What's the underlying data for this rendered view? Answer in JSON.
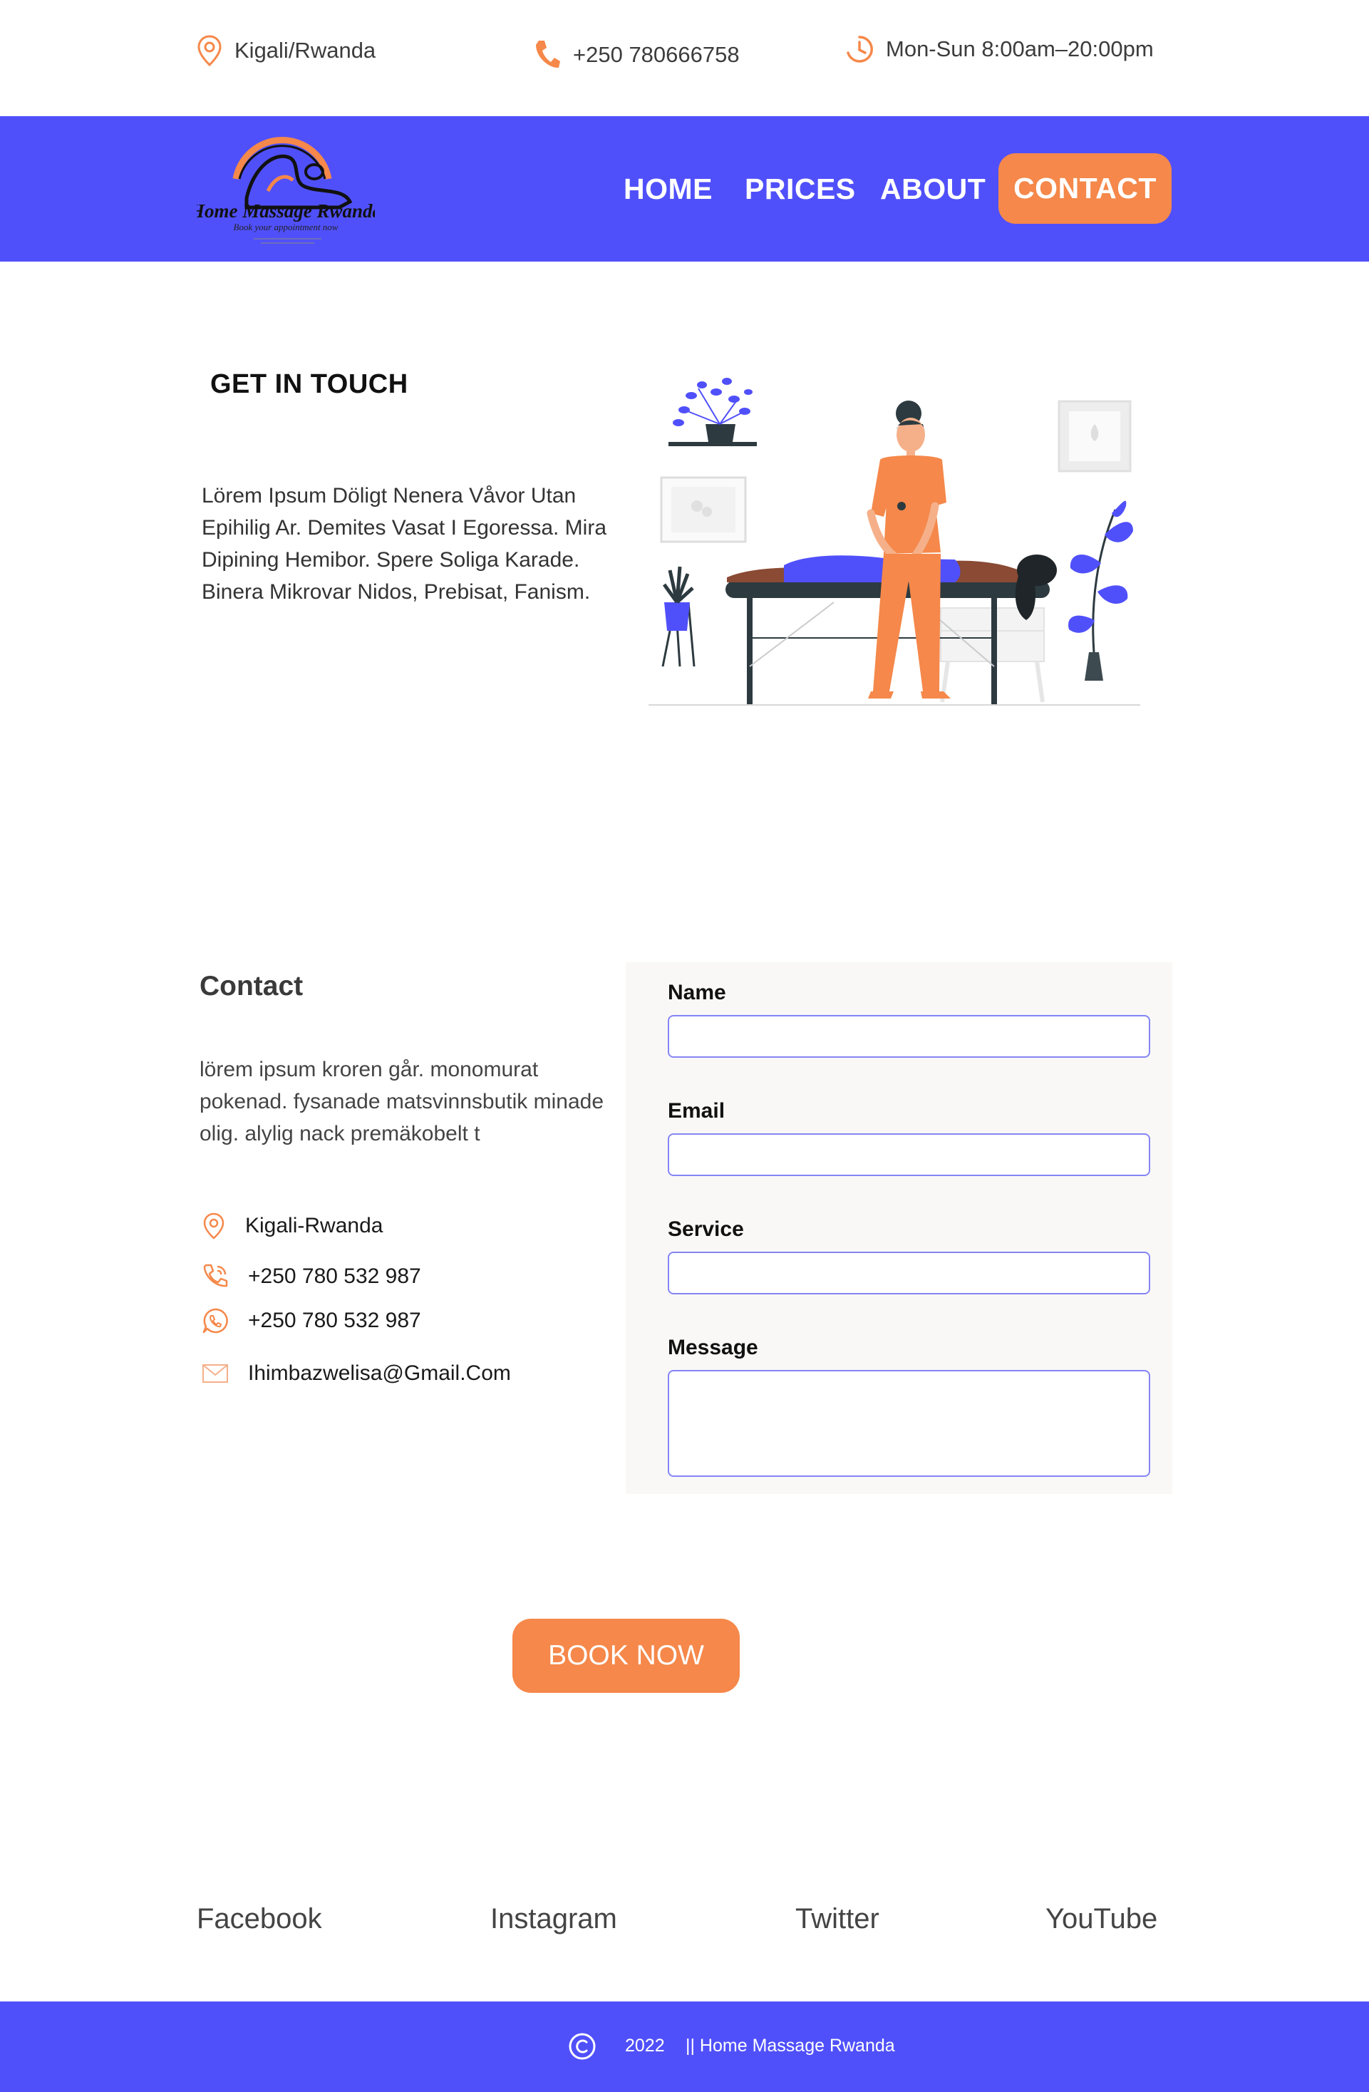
{
  "topbar": {
    "location": "Kigali/Rwanda",
    "phone": "+250 780666758",
    "hours": "Mon-Sun 8:00am–20:00pm"
  },
  "nav": {
    "logo_title": "Home Massage Rwanda",
    "logo_tagline": "Book your appointment now",
    "home": "HOME",
    "prices": "PRICES",
    "about": "ABOUT",
    "contact": "CONTACT"
  },
  "touch": {
    "title": "GET IN  TOUCH",
    "body": "Lörem Ipsum Döligt Nenera Våvor Utan Epihilig Ar. Demites Vasat I Egoressa. Mira Dipining Hemibor. Spere Soliga Karade. Binera Mikrovar Nidos, Prebisat, Fanism."
  },
  "contact": {
    "title": "Contact",
    "body": "lörem ipsum kroren går. monomurat pokenad. fysanade matsvinnsbutik minade olig. alylig nack premäkobelt t",
    "address": "Kigali-Rwanda",
    "phone": "+250  780 532 987",
    "whatsapp": "+250  780 532 987",
    "email": "Ihimbazwelisa@Gmail.Com"
  },
  "form": {
    "name_label": "Name",
    "email_label": "Email",
    "service_label": "Service",
    "message_label": "Message",
    "name_value": "",
    "email_value": "",
    "service_value": "",
    "message_value": ""
  },
  "book_button": "BOOK NOW",
  "social": {
    "facebook": "Facebook",
    "instagram": "Instagram",
    "twitter": "Twitter",
    "youtube": "YouTube"
  },
  "footer": {
    "year": "2022",
    "name": "|| Home Massage Rwanda"
  },
  "colors": {
    "brand_blue": "#5050fb",
    "accent_orange": "#f5884a"
  },
  "icons": {
    "location": "location-pin-icon",
    "phone": "phone-icon",
    "clock": "clock-icon",
    "phone_call": "phone-call-icon",
    "whatsapp": "whatsapp-icon",
    "mail": "mail-icon",
    "copyright": "copyright-icon"
  }
}
